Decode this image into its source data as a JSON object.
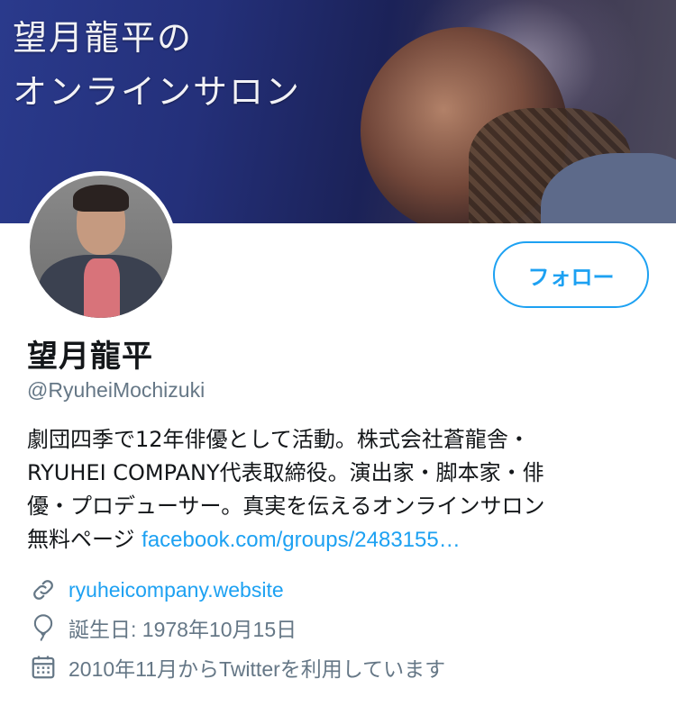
{
  "banner": {
    "title_line1": "望月龍平の",
    "title_line2": "オンラインサロン"
  },
  "profile": {
    "display_name": "望月龍平",
    "handle": "@RyuheiMochizuki",
    "follow_label": "フォロー",
    "bio_lines": [
      "劇団四季で12年俳優として活動。株式会社蒼龍舎・",
      "RYUHEI COMPANY代表取締役。演出家・脚本家・俳",
      "優・プロデューサー。真実を伝えるオンラインサロン"
    ],
    "bio_last_prefix": "無料ページ ",
    "bio_link": "facebook.com/groups/2483155…",
    "website": "ryuheicompany.website",
    "birthday": "誕生日: 1978年10月15日",
    "joined": "2010年11月からTwitterを利用しています"
  },
  "icons": {
    "website": "link-icon",
    "birthday": "balloon-icon",
    "joined": "calendar-icon"
  },
  "colors": {
    "accent": "#1da1f2",
    "secondary_text": "#657786",
    "primary_text": "#14171a"
  }
}
